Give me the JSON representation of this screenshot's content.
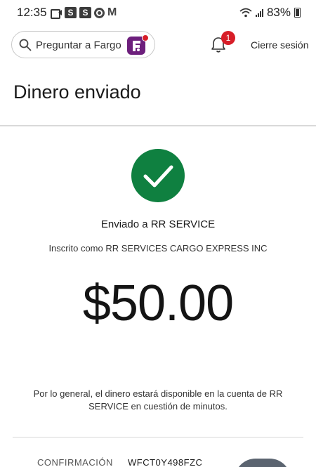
{
  "status_bar": {
    "time": "12:35",
    "badges": [
      "S",
      "S"
    ],
    "gmail_glyph": "M",
    "battery": "83%",
    "icons": [
      "video-icon",
      "chrome-icon",
      "gmail-icon",
      "wifi-icon",
      "signal-icon",
      "battery-icon"
    ]
  },
  "header": {
    "search_placeholder": "Preguntar a Fargo",
    "notification_count": "1",
    "logout_label": "Cierre sesión"
  },
  "page": {
    "title": "Dinero enviado"
  },
  "confirmation": {
    "sent_to": "Enviado a RR SERVICE",
    "enrolled_as": "Inscrito como RR SERVICES CARGO EXPRESS INC",
    "amount": "$50.00",
    "availability_note": "Por lo general, el dinero estará disponible en la cuenta de RR SERVICE en cuestión de minutos.",
    "confirmation_label": "CONFIRMACIÓN",
    "confirmation_code": "WFCT0Y498FZC"
  },
  "colors": {
    "success_green": "#0f8040",
    "brand_red": "#d71e28",
    "fargo_purple": "#6d1f7c"
  }
}
